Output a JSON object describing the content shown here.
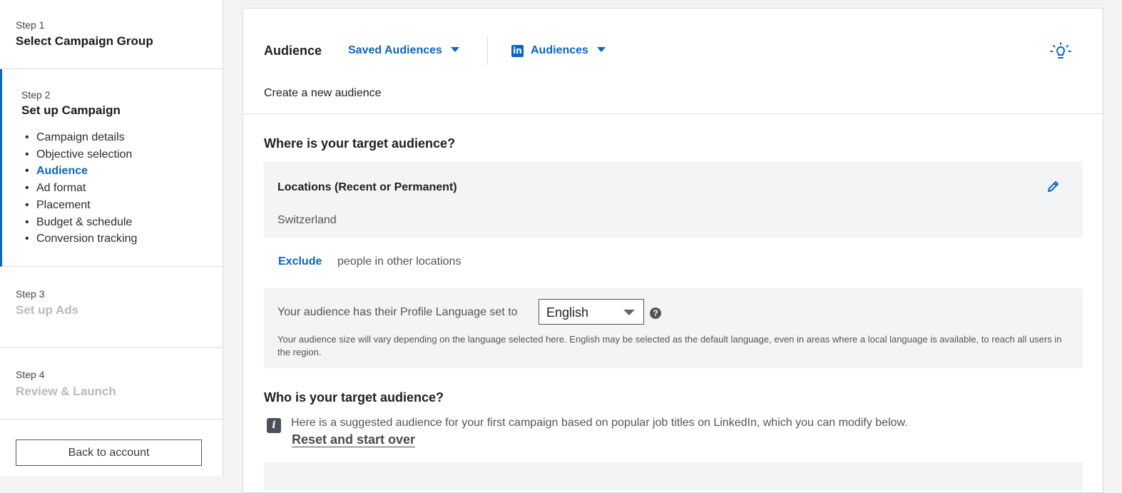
{
  "sidebar": {
    "steps": [
      {
        "label": "Step 1",
        "title": "Select Campaign Group"
      },
      {
        "label": "Step 2",
        "title": "Set up Campaign",
        "substeps": [
          "Campaign details",
          "Objective selection",
          "Audience",
          "Ad format",
          "Placement",
          "Budget & schedule",
          "Conversion tracking"
        ]
      },
      {
        "label": "Step 3",
        "title": "Set up Ads"
      },
      {
        "label": "Step 4",
        "title": "Review & Launch"
      }
    ],
    "back_label": "Back to account"
  },
  "header": {
    "title": "Audience",
    "saved_audiences": "Saved Audiences",
    "linkedin_logo": "in",
    "audiences": "Audiences",
    "create_new": "Create a new audience"
  },
  "where": {
    "question": "Where is your target audience?",
    "locations_title": "Locations (Recent or Permanent)",
    "locations_value": "Switzerland",
    "exclude_link": "Exclude",
    "exclude_text": "people in other locations",
    "language_label": "Your audience has their Profile Language set to",
    "language_value": "English",
    "help_symbol": "?",
    "language_note": "Your audience size will vary depending on the language selected here. English may be selected as the default language, even in areas where a local language is available, to reach all users in the region."
  },
  "who": {
    "question": "Who is your target audience?",
    "info_symbol": "i",
    "suggestion": "Here is a suggested audience for your first campaign based on popular job titles on LinkedIn, which you can modify below.",
    "reset_link": "Reset and start over"
  },
  "colors": {
    "accent": "#0a66c2",
    "panel": "#f3f4f6",
    "disabled": "#b9b9b9"
  },
  "icons": [
    "linkedin-logo-icon",
    "lightbulb-icon",
    "pencil-icon",
    "help-icon",
    "info-icon",
    "caret-down-icon"
  ]
}
